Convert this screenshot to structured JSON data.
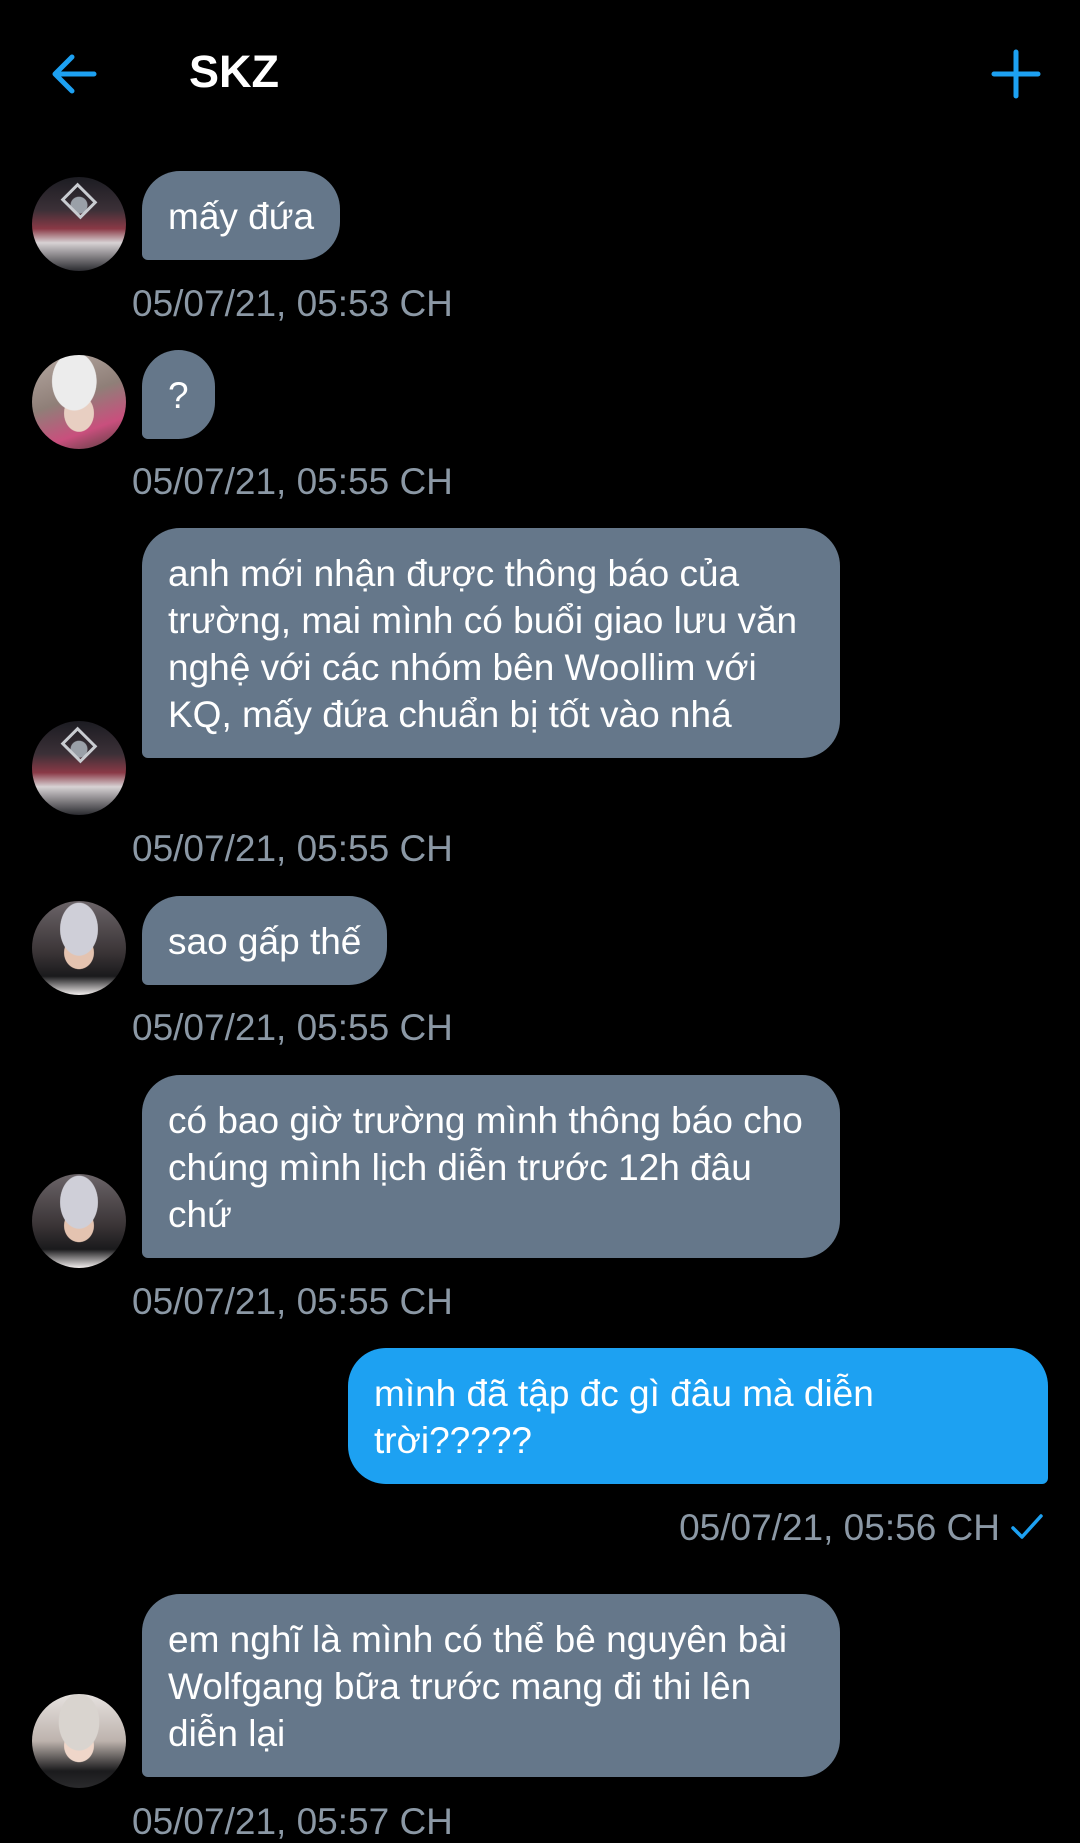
{
  "header": {
    "title": "SKZ",
    "back_icon": "arrow-left-icon",
    "add_icon": "plus-icon",
    "accent_color": "#1da1f2"
  },
  "messages": [
    {
      "text": "mấy đứa",
      "time": "05/07/21, 05:53 CH",
      "avatar": "group-photo"
    },
    {
      "text": "?",
      "time": "05/07/21, 05:55 CH",
      "avatar": "beanie-photo"
    },
    {
      "text": "anh mới nhận được thông báo của trường, mai mình có buổi giao lưu văn nghệ với các nhóm bên Woollim với KQ, mấy đứa chuẩn bị tốt vào nhá",
      "time": "05/07/21, 05:55 CH",
      "avatar": "group-photo"
    },
    {
      "text": "sao gấp thế",
      "time": "05/07/21, 05:55 CH",
      "avatar": "silver-hair-photo"
    },
    {
      "text": "có bao giờ trường mình thông báo cho chúng mình lịch diễn trước 12h đâu chứ",
      "time": "05/07/21, 05:55 CH",
      "avatar": "silver-hair-photo"
    },
    {
      "text": "mình đã tập đc gì đâu mà diễn trời?????",
      "time": "05/07/21, 05:56 CH",
      "sender": "me",
      "status_icon": "checkmark-icon"
    },
    {
      "text": "em nghĩ là mình có thể bê nguyên bài Wolfgang bữa trước mang đi thi lên diễn lại",
      "time": "05/07/21, 05:57 CH",
      "avatar": "blonde-hair-photo"
    }
  ],
  "colors": {
    "background": "#000000",
    "received_bubble": "#65778a",
    "sent_bubble": "#1da1f2",
    "timestamp": "#8b98a5"
  }
}
